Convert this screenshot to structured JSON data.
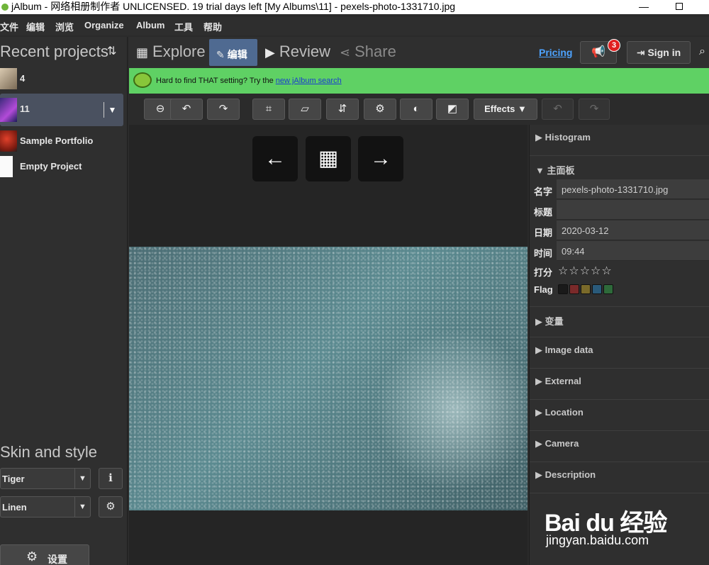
{
  "window": {
    "title": "jAlbum - 网络相册制作者 UNLICENSED. 19 trial days left [My Albums\\11] - pexels-photo-1331710.jpg"
  },
  "menu": [
    "文件",
    "编辑",
    "浏览",
    "Organize",
    "Album",
    "工具",
    "帮助"
  ],
  "sidebar": {
    "recent_title": "Recent projects",
    "projects": [
      {
        "label": "4"
      },
      {
        "label": "11"
      },
      {
        "label": "Sample Portfolio"
      },
      {
        "label": "Empty Project"
      }
    ],
    "skin_title": "Skin and style",
    "skin": "Tiger",
    "style": "Linen",
    "settings_label": "设置"
  },
  "tabs": {
    "explore": "Explore",
    "edit": "编辑",
    "review": "Review",
    "share": "Share"
  },
  "header": {
    "pricing": "Pricing",
    "notifications": "3",
    "sign_in": "Sign in"
  },
  "tip": {
    "text": "Hard to find THAT setting? Try the ",
    "link": "new jAlbum search"
  },
  "toolbar": {
    "effects": "Effects"
  },
  "panel": {
    "histogram": "Histogram",
    "main_panel": "主面板",
    "fields": [
      {
        "key": "名字",
        "value": "pexels-photo-1331710.jpg"
      },
      {
        "key": "标题",
        "value": ""
      },
      {
        "key": "日期",
        "value": "2020-03-12"
      },
      {
        "key": "时间",
        "value": "09:44"
      }
    ],
    "rating_label": "打分",
    "stars": "☆☆☆☆☆",
    "flag_label": "Flag",
    "flag_colors": [
      "#1a1a1a",
      "#7a2a2a",
      "#7a6a2a",
      "#2a5a7a",
      "#2e6a3a"
    ],
    "sections": [
      "变量",
      "Image data",
      "External",
      "Location",
      "Camera",
      "Description"
    ]
  },
  "watermark": {
    "logo": "Bai du 经验",
    "url": "jingyan.baidu.com"
  }
}
